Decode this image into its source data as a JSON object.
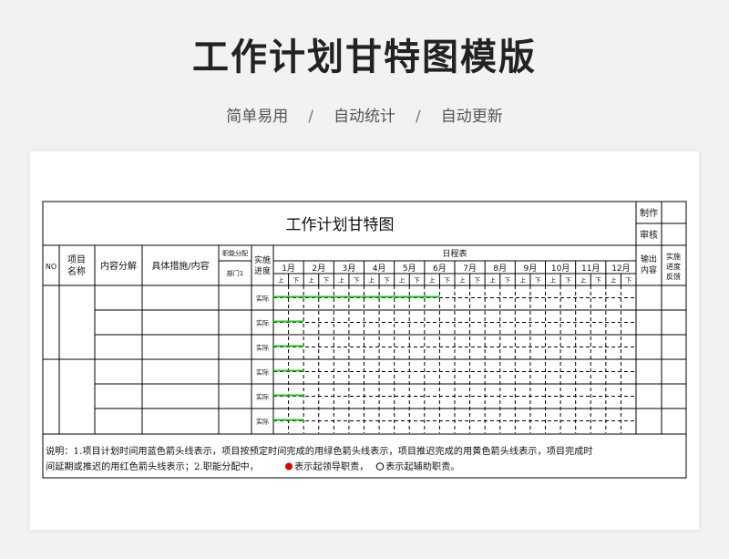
{
  "header": {
    "title": "工作计划甘特图模版",
    "features": [
      "简单易用",
      "自动统计",
      "自动更新"
    ],
    "separator": "/"
  },
  "sheet": {
    "title": "工作计划甘特图",
    "made_label": "制作",
    "review_label": "审核",
    "columns": {
      "no": "NO",
      "item_name_l1": "项目",
      "item_name_l2": "名称",
      "breakdown": "内容分解",
      "measures": "具体措施/内容",
      "roles": "职能分配",
      "dept": "部门1",
      "impl_l1": "实施",
      "impl_l2": "进度",
      "schedule": "日程表",
      "output_l1": "输出",
      "output_l2": "内容",
      "feedback_l1": "实施",
      "feedback_l2": "进度",
      "feedback_l3": "反馈"
    },
    "months": [
      "1月",
      "2月",
      "3月",
      "4月",
      "5月",
      "6月",
      "7月",
      "8月",
      "9月",
      "10月",
      "11月",
      "12月"
    ],
    "halves": [
      "上",
      "下"
    ],
    "rows": [
      {
        "status": "实际",
        "progress_halves": 11
      },
      {
        "status": "实际",
        "progress_halves": 2
      },
      {
        "status": "实际",
        "progress_halves": 2
      },
      {
        "status": "实际",
        "progress_halves": 2
      },
      {
        "status": "实际",
        "progress_halves": 2
      },
      {
        "status": "实际",
        "progress_halves": 2
      }
    ],
    "note_line1": "说明：1.项目计划时间用蓝色箭头线表示，项目按预定时间完成的用绿色箭头线表示，项目推迟完成的用黄色箭头线表示，项目完成时",
    "note_line2a": "间延期或推迟的用红色箭头线表示；2.职能分配中，",
    "note_line2b": "表示起领导职责，",
    "note_line2c": "表示起辅助职责。",
    "colors": {
      "actual_line": "#22c51e",
      "lead_dot": "#e00000"
    }
  }
}
